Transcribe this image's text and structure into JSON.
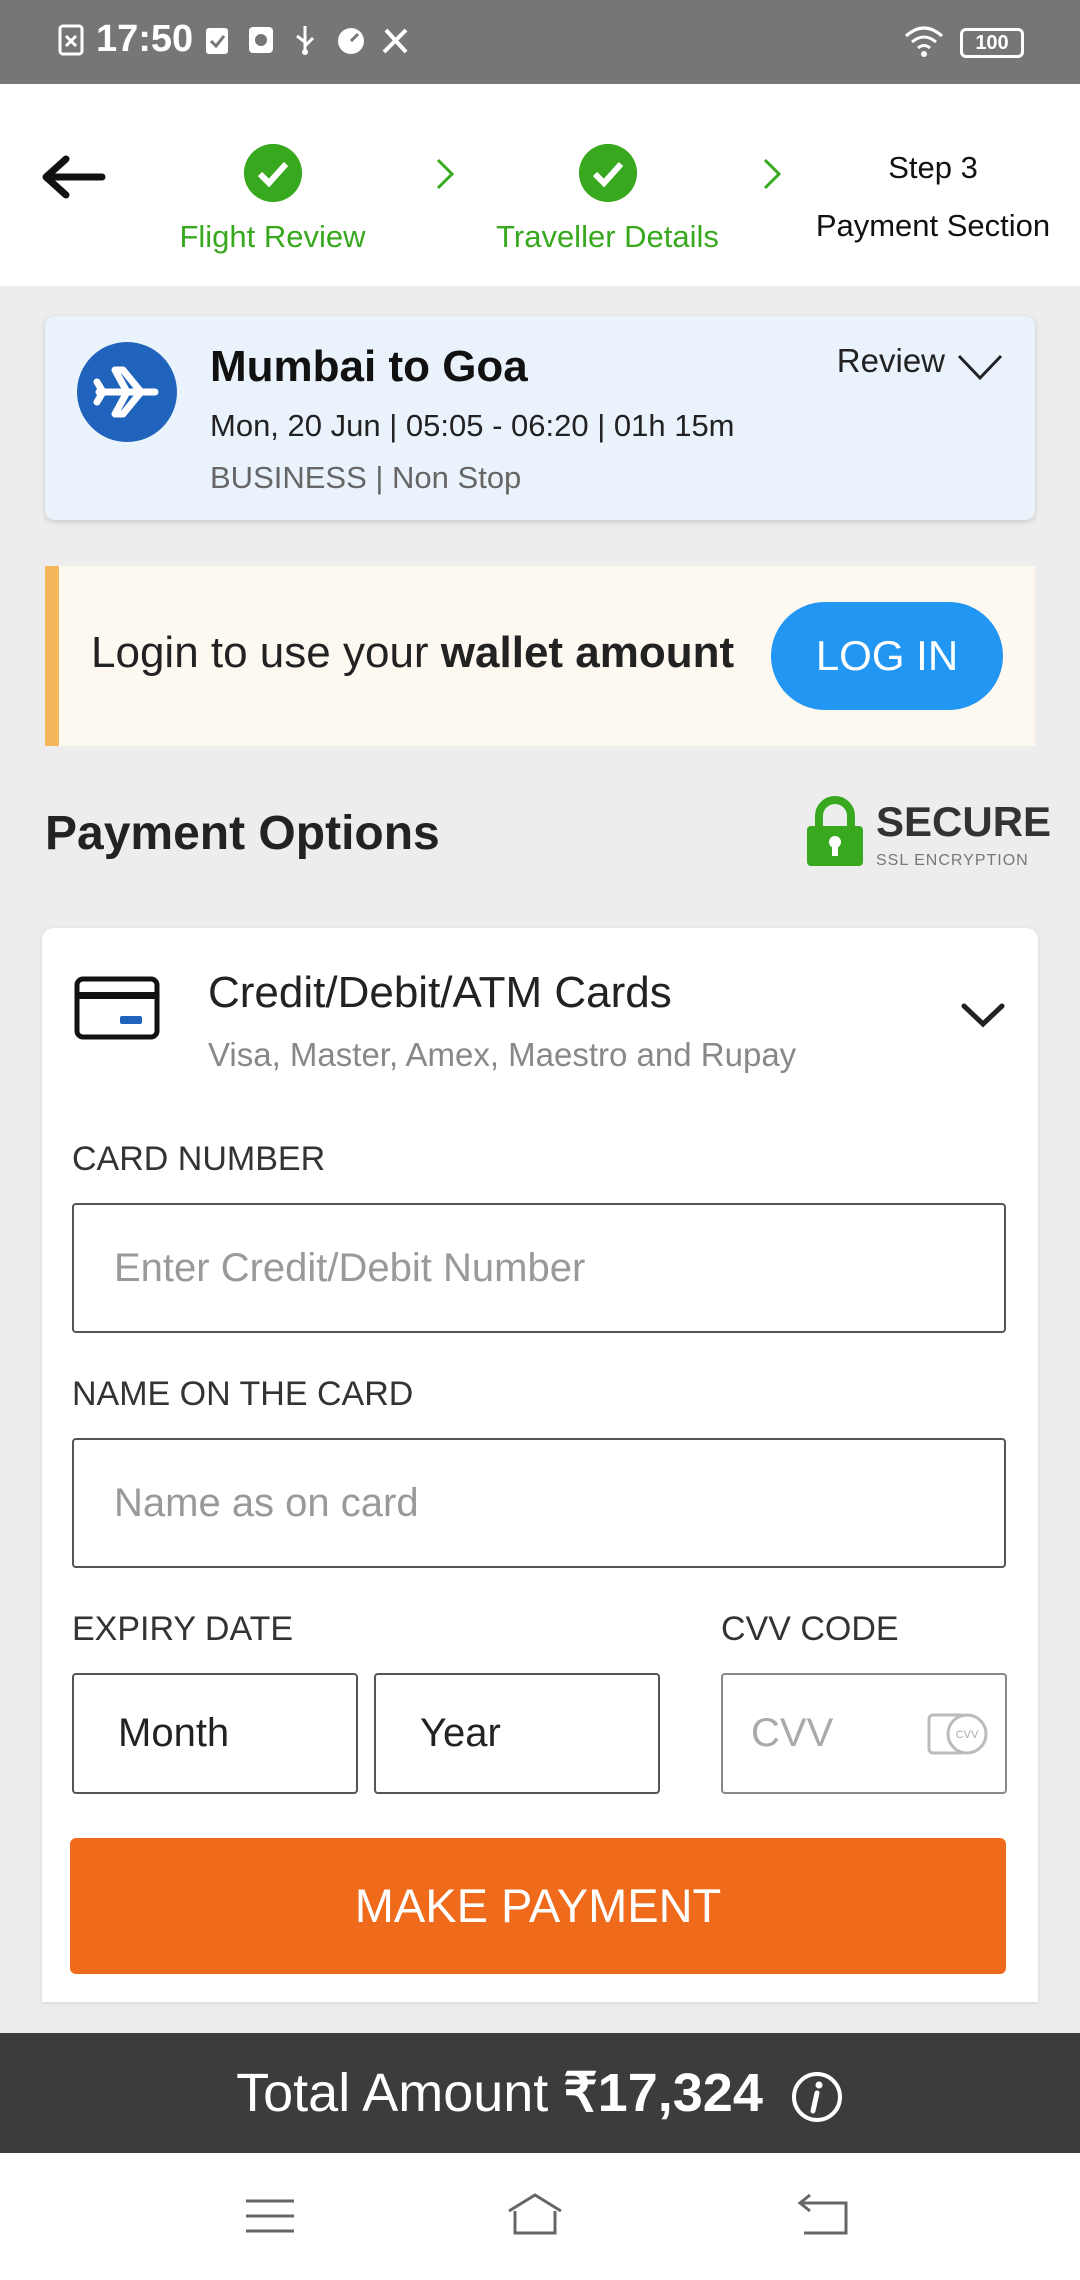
{
  "status": {
    "time": "17:50",
    "battery": "100"
  },
  "stepper": {
    "step1": "Flight Review",
    "step2": "Traveller Details",
    "step3_num": "Step 3",
    "step3": "Payment Section"
  },
  "flight": {
    "title": "Mumbai to Goa",
    "details": "Mon, 20 Jun | 05:05 - 06:20 | 01h 15m",
    "class": "BUSINESS | Non Stop",
    "review": "Review"
  },
  "login": {
    "text_prefix": "Login to use your ",
    "text_bold": "wallet amount",
    "button": "LOG IN"
  },
  "payment": {
    "title": "Payment Options",
    "secure": "SECURE",
    "secure_sub": "SSL ENCRYPTION"
  },
  "card": {
    "title": "Credit/Debit/ATM Cards",
    "subtitle": "Visa, Master, Amex, Maestro and Rupay",
    "number_label": "CARD NUMBER",
    "number_placeholder": "Enter Credit/Debit Number",
    "name_label": "NAME ON THE CARD",
    "name_placeholder": "Name as on card",
    "expiry_label": "EXPIRY DATE",
    "month": "Month",
    "year": "Year",
    "cvv_label": "CVV CODE",
    "cvv_placeholder": "CVV",
    "cvv_icon_text": "CVV",
    "pay_button": "MAKE PAYMENT"
  },
  "total": {
    "label": "Total Amount ",
    "amount": "₹17,324"
  },
  "colors": {
    "green": "#38a81f",
    "blue": "#2196f3",
    "orange": "#ef6a1a",
    "navy": "#1f63bd"
  }
}
